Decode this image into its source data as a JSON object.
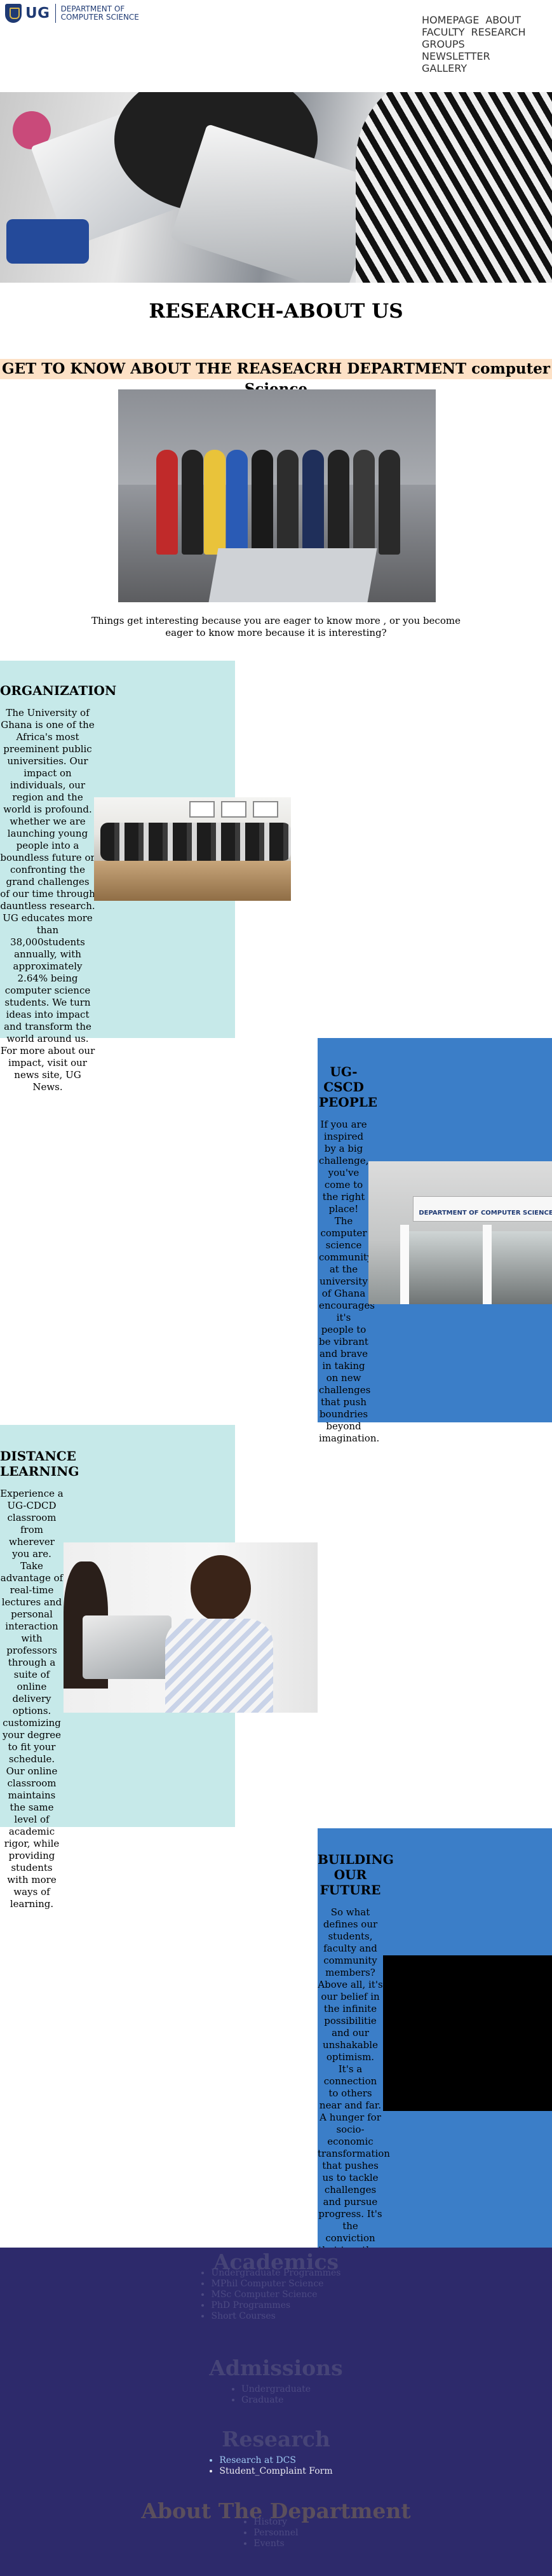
{
  "header": {
    "logo_text": "UG",
    "dept_line1": "DEPARTMENT OF",
    "dept_line2": "COMPUTER SCIENCE",
    "nav": [
      "HOMEPAGE",
      "ABOUT",
      "FACULTY",
      "RESEARCH",
      "GROUPS",
      "NEWSLETTER",
      "GALLERY"
    ]
  },
  "page": {
    "title": "RESEARCH-ABOUT US",
    "banner": "GET TO KNOW ABOUT THE REASEACRH DEPARTMENT computer Science",
    "intro": "Things get interesting because you are eager to know more , or you become eager to know more because it is interesting?"
  },
  "sections": {
    "organization": {
      "heading": "ORGANIZATION",
      "body": "The University of Ghana is one of the Africa's most preeminent public universities. Our impact on individuals, our region and the world is profound. whether we are launching young people into a boundless future or confronting the grand challenges of our time through dauntless research. UG educates more than 38,000students annually, with approximately 2.64% being computer science students. We turn ideas into impact and transform the world around us. For more about our impact, visit our news site, UG News."
    },
    "people": {
      "heading": "UG-CSCD PEOPLE",
      "body": "If you are inspired by a big challenge, you've come to the right place! The computer science community at the university of Ghana encourages it's people to be vibrant and brave in taking on new challenges that push boundries beyond imagination.",
      "sign_text": "DEPARTMENT OF COMPUTER SCIENCE"
    },
    "distance": {
      "heading": "DISTANCE LEARNING",
      "body": "Experience a UG-CDCD classroom from wherever you are. Take advantage of real-time lectures and personal interaction with professors through a suite of online delivery options. customizing your degree to fit your schedule. Our online classroom maintains the same level of academic rigor, while providing students with more ways of learning."
    },
    "future": {
      "heading": "BUILDING OUR FUTURE",
      "body": "So what defines our students, faculty and community members? Above all, it's our belief in the infinite possibilitie and our unshakable optimism. It's a connection to others near and far. A hunger for socio-economic transformation that pushes us to tackle challenges and pursue progress. It's the conviction that together we can create a world of good. Join us on the journey."
    }
  },
  "footer": {
    "academics": {
      "heading": "Academics",
      "items": [
        "Undergraduate Programmes",
        "MPhil Computer Science",
        "MSc Computer Science",
        "PhD Programmes",
        "Short Courses"
      ]
    },
    "admissions": {
      "heading": "Admissions",
      "items": [
        "Undergraduate",
        "Graduate"
      ]
    },
    "research": {
      "heading": "Research",
      "items": [
        "Research at DCS",
        "Student_Complaint Form"
      ]
    },
    "about": {
      "heading": "About The Department",
      "items": [
        "History",
        "Personnel",
        "Events"
      ]
    }
  },
  "colors": {
    "teal_panel": "#c6e9e9",
    "blue_panel": "#3b7ec8",
    "banner": "#fde1c6",
    "footer": "#2d2a6b",
    "brand": "#1f3a73"
  }
}
